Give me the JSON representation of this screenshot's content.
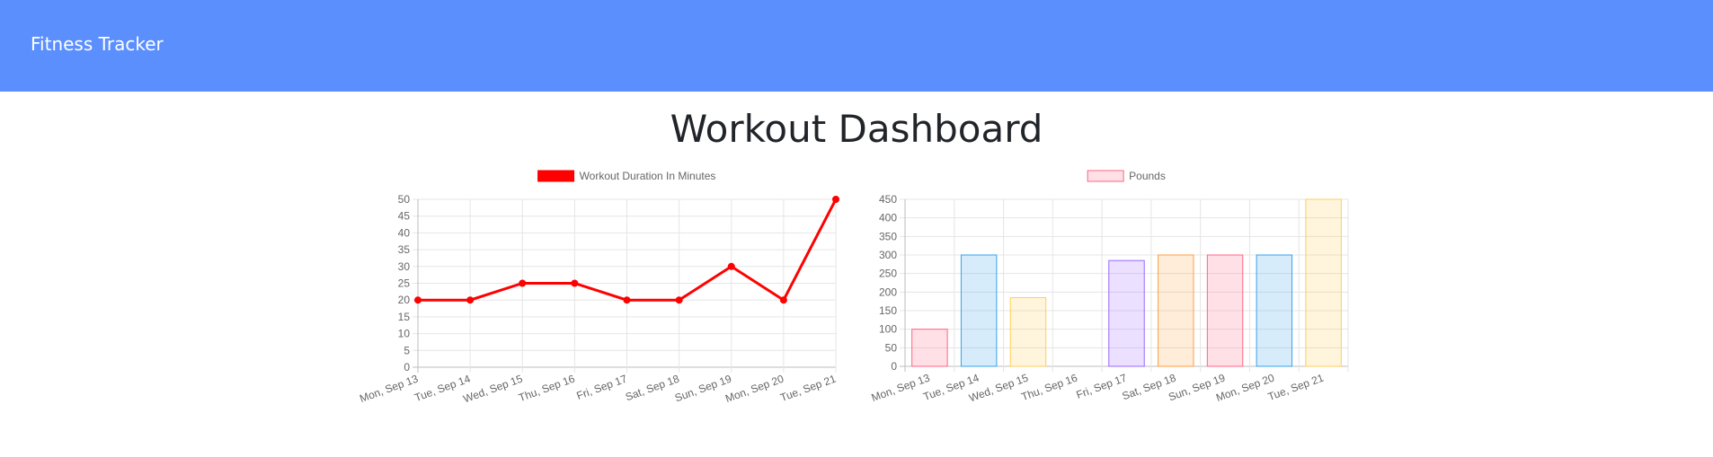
{
  "header": {
    "brand": "Fitness Tracker"
  },
  "main": {
    "title": "Workout Dashboard"
  },
  "colors": {
    "navbar": "#5b8ffe",
    "line": "#ff0000"
  },
  "chart_data": [
    {
      "type": "line",
      "legend": "Workout Duration In Minutes",
      "categories": [
        "Mon, Sep 13",
        "Tue, Sep 14",
        "Wed, Sep 15",
        "Thu, Sep 16",
        "Fri, Sep 17",
        "Sat, Sep 18",
        "Sun, Sep 19",
        "Mon, Sep 20",
        "Tue, Sep 21"
      ],
      "series": [
        {
          "name": "Workout Duration In Minutes",
          "values": [
            20,
            20,
            25,
            25,
            20,
            20,
            30,
            20,
            50
          ],
          "color": "#ff0000"
        }
      ],
      "ylim": [
        0,
        50
      ],
      "yticks": [
        0,
        5,
        10,
        15,
        20,
        25,
        30,
        35,
        40,
        45,
        50
      ],
      "grid": true,
      "legend_position": "top"
    },
    {
      "type": "bar",
      "legend": "Pounds",
      "categories": [
        "Mon, Sep 13",
        "Tue, Sep 14",
        "Wed, Sep 15",
        "Thu, Sep 16",
        "Fri, Sep 17",
        "Sat, Sep 18",
        "Sun, Sep 19",
        "Mon, Sep 20",
        "Tue, Sep 21"
      ],
      "series": [
        {
          "name": "Pounds",
          "values": [
            100,
            300,
            185,
            0,
            285,
            300,
            300,
            300,
            450
          ]
        }
      ],
      "bar_colors": [
        "#ff6384",
        "#36a2eb",
        "#ffce56",
        "#4bc0c0",
        "#9966ff",
        "#ff9f40",
        "#ff6384",
        "#36a2eb",
        "#ffce56"
      ],
      "ylim": [
        0,
        450
      ],
      "yticks": [
        0,
        50,
        100,
        150,
        200,
        250,
        300,
        350,
        400,
        450
      ],
      "grid": true,
      "legend_position": "top"
    }
  ]
}
